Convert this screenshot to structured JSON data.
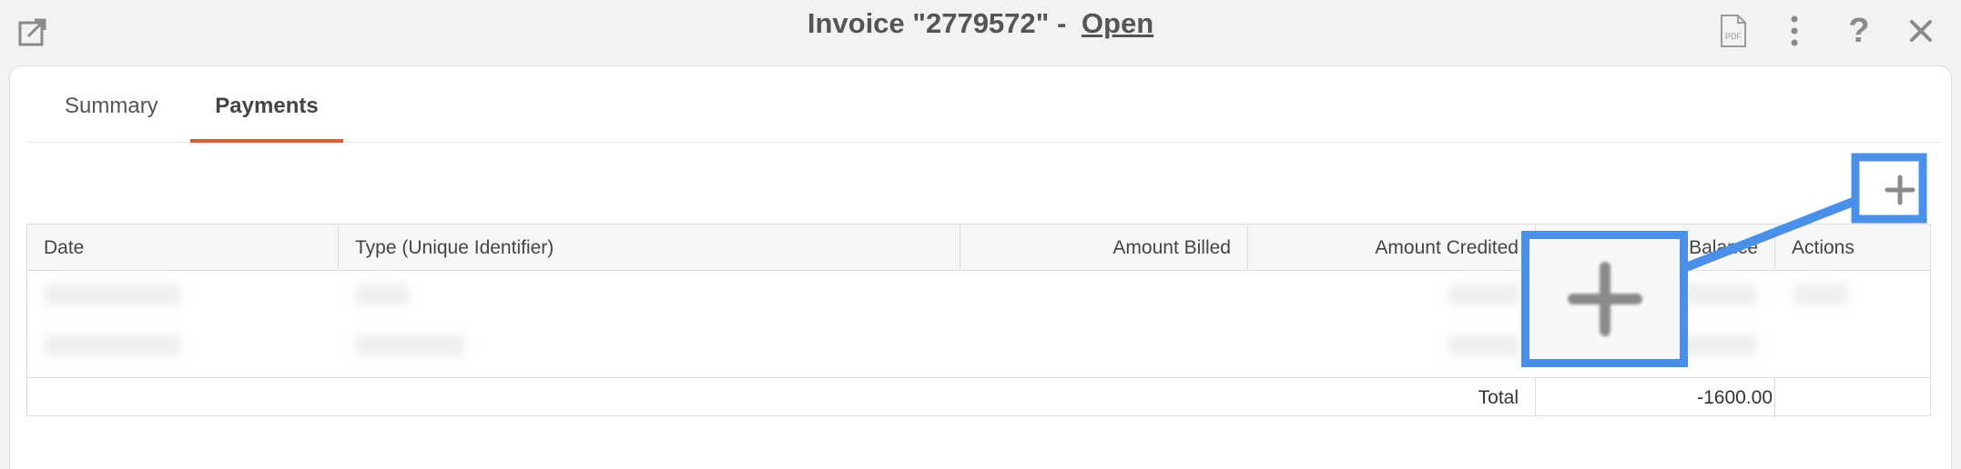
{
  "header": {
    "title_prefix": "Invoice \"2779572\" -",
    "status": "Open",
    "icons": [
      "popout-icon",
      "pdf-icon",
      "more-vertical-icon",
      "help-icon",
      "close-icon"
    ],
    "help_glyph": "?",
    "pdf_label": "PDF"
  },
  "tabs": [
    {
      "label": "Summary",
      "active": false
    },
    {
      "label": "Payments",
      "active": true
    }
  ],
  "table": {
    "columns": [
      "Date",
      "Type (Unique Identifier)",
      "Amount Billed",
      "Amount Credited",
      "Balance",
      "Actions"
    ],
    "rows_obscured": 2,
    "total_label": "Total",
    "total_value": "-1600.00"
  },
  "colors": {
    "accent": "#e05a33",
    "callout": "#4a90e8"
  }
}
